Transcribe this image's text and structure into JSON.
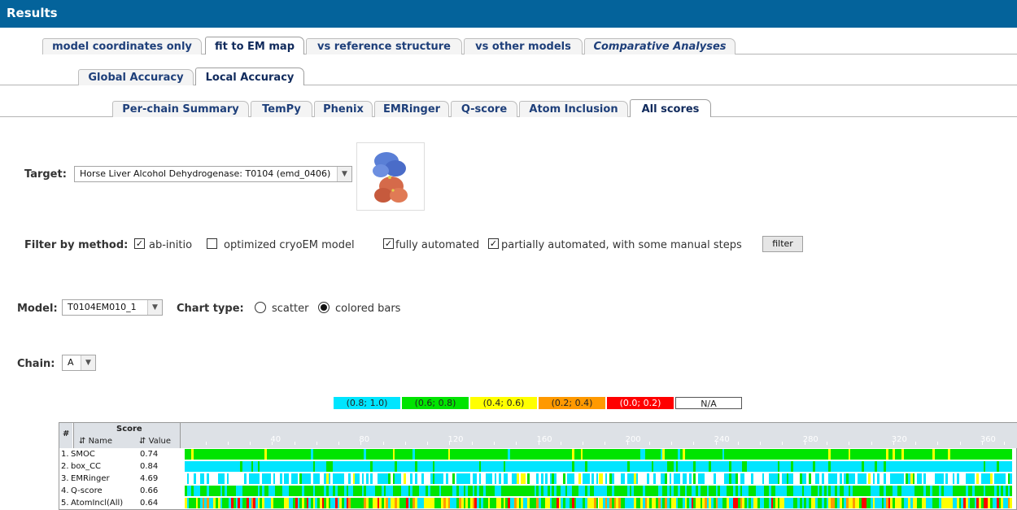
{
  "header": {
    "title": "Results"
  },
  "tabs1": [
    {
      "label": "model coordinates only",
      "active": false
    },
    {
      "label": "fit to EM map",
      "active": true
    },
    {
      "label": "vs reference structure",
      "active": false
    },
    {
      "label": "vs other models",
      "active": false
    },
    {
      "label": "Comparative Analyses",
      "active": false
    }
  ],
  "tabs2": [
    {
      "label": "Global Accuracy",
      "active": false
    },
    {
      "label": "Local Accuracy",
      "active": true
    }
  ],
  "tabs3": [
    {
      "label": "Per-chain Summary",
      "active": false
    },
    {
      "label": "TemPy",
      "active": false
    },
    {
      "label": "Phenix",
      "active": false
    },
    {
      "label": "EMRinger",
      "active": false
    },
    {
      "label": "Q-score",
      "active": false
    },
    {
      "label": "Atom Inclusion",
      "active": false
    },
    {
      "label": "All scores",
      "active": true
    }
  ],
  "target": {
    "label": "Target:",
    "value": "Horse Liver Alcohol Dehydrogenase: T0104 (emd_0406)"
  },
  "filter": {
    "label": "Filter by method:",
    "options": [
      {
        "label": "ab-initio",
        "checked": true
      },
      {
        "label": "optimized cryoEM model",
        "checked": false
      },
      {
        "label": "fully automated",
        "checked": true
      },
      {
        "label": "partially automated, with some manual steps",
        "checked": true
      }
    ],
    "button": "filter"
  },
  "model": {
    "label": "Model:",
    "value": "T0104EM010_1"
  },
  "chart_type": {
    "label": "Chart type:",
    "options": [
      "scatter",
      "colored bars"
    ],
    "selected": "colored bars"
  },
  "chain": {
    "label": "Chain:",
    "value": "A"
  },
  "legend": [
    {
      "label": "(0.8; 1.0)",
      "color": "#00e5ff"
    },
    {
      "label": "(0.6; 0.8)",
      "color": "#00e400"
    },
    {
      "label": "(0.4; 0.6)",
      "color": "#ffff00"
    },
    {
      "label": "(0.2; 0.4)",
      "color": "#ff9900"
    },
    {
      "label": "(0.0; 0.2)",
      "color": "#ff0000"
    },
    {
      "label": "N/A",
      "color": "#ffffff"
    }
  ],
  "table": {
    "header_num": "#",
    "header_score": "Score",
    "header_name": "Name",
    "header_value": "Value",
    "rows": [
      {
        "num": "1.",
        "name": "SMOC",
        "value": "0.74"
      },
      {
        "num": "2.",
        "name": "box_CC",
        "value": "0.84"
      },
      {
        "num": "3.",
        "name": "EMRinger",
        "value": "4.69"
      },
      {
        "num": "4.",
        "name": "Q-score",
        "value": "0.66"
      },
      {
        "num": "5.",
        "name": "AtomIncl(All)",
        "value": "0.64"
      }
    ],
    "ticks": [
      "40",
      "80",
      "120",
      "160",
      "200",
      "240",
      "280",
      "320",
      "360"
    ]
  },
  "chart_data": {
    "type": "heatmap",
    "x_range": [
      1,
      374
    ],
    "x_ticks": [
      40,
      80,
      120,
      160,
      200,
      240,
      280,
      320,
      360
    ],
    "rows": [
      "SMOC",
      "box_CC",
      "EMRinger",
      "Q-score",
      "AtomIncl(All)"
    ],
    "row_values": [
      0.74,
      0.84,
      4.69,
      0.66,
      0.64
    ],
    "color_bins": [
      {
        "range": [
          0.8,
          1.0
        ],
        "color": "#00e5ff"
      },
      {
        "range": [
          0.6,
          0.8
        ],
        "color": "#00e400"
      },
      {
        "range": [
          0.4,
          0.6
        ],
        "color": "#ffff00"
      },
      {
        "range": [
          0.2,
          0.4
        ],
        "color": "#ff9900"
      },
      {
        "range": [
          0.0,
          0.2
        ],
        "color": "#ff0000"
      }
    ],
    "na_color": "#ffffff",
    "row_descriptions": [
      "mostly (0.6; 0.8) with a few darker/(0.8; 1.0) residues",
      "mostly (0.8; 1.0) with scattered (0.6; 0.8) residues",
      "alternating (0.8; 1.0) and N/A residues with sparse (0.4; 0.6)/(0.6; 0.8)",
      "mostly (0.6; 0.8) with frequent (0.8; 1.0) residues",
      "mixed across all bins, frequent (0.0; 0.2) and (0.4; 0.6)"
    ]
  }
}
